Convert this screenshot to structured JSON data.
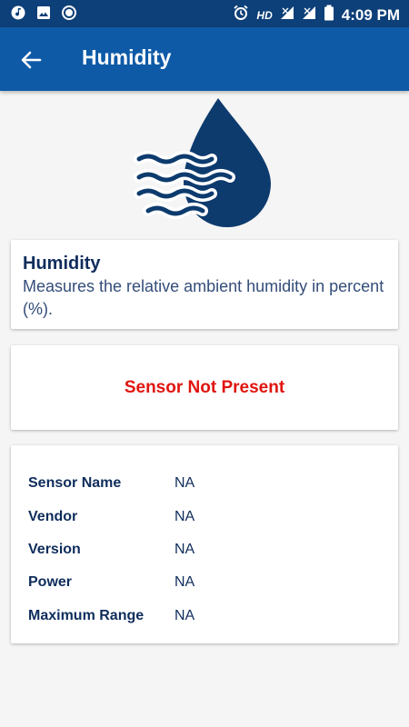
{
  "status_bar": {
    "hd": "HD",
    "time": "4:09 PM",
    "icons": [
      "music-note-icon",
      "image-icon",
      "circle-icon",
      "alarm-icon",
      "signal-icon",
      "signal-icon",
      "battery-icon"
    ]
  },
  "app_bar": {
    "title": "Humidity",
    "back_icon": "arrow-back-icon"
  },
  "hero_icon": "humidity-drop-icon",
  "info": {
    "title": "Humidity",
    "description": "Measures the relative ambient humidity in percent (%)."
  },
  "status": {
    "text": "Sensor Not Present"
  },
  "details": [
    {
      "label": "Sensor Name",
      "value": "NA"
    },
    {
      "label": "Vendor",
      "value": "NA"
    },
    {
      "label": "Version",
      "value": "NA"
    },
    {
      "label": "Power",
      "value": "NA"
    },
    {
      "label": "Maximum Range",
      "value": "NA"
    }
  ],
  "colors": {
    "status_bar": "#0d3f78",
    "app_bar": "#0e5aa7",
    "drop": "#0d3b6e",
    "heading": "#0f2d5c",
    "error": "#e0140f"
  }
}
